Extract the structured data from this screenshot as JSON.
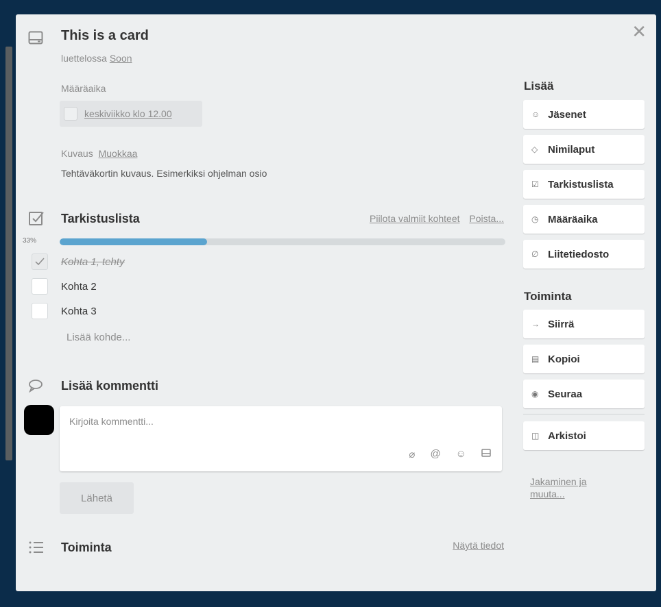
{
  "card": {
    "title": "This is a card",
    "in_list_prefix": "luettelossa",
    "list_name": "Soon",
    "close_symbol": "✕"
  },
  "due": {
    "label": "Määräaika",
    "value": "keskiviikko klo 12.00"
  },
  "description": {
    "label": "Kuvaus",
    "edit": "Muokkaa",
    "text": "Tehtäväkortin kuvaus. Esimerkiksi ohjelman osio"
  },
  "checklist": {
    "title": "Tarkistuslista",
    "hide_done": "Piilota valmiit kohteet",
    "delete": "Poista...",
    "percent_label": "33%",
    "progress": 0.33,
    "items": [
      {
        "text": "Kohta 1, tehty",
        "done": true
      },
      {
        "text": "Kohta 2",
        "done": false
      },
      {
        "text": "Kohta 3",
        "done": false
      }
    ],
    "add_item": "Lisää kohde..."
  },
  "comment": {
    "title": "Lisää kommentti",
    "placeholder": "Kirjoita kommentti...",
    "send": "Lähetä",
    "tools": [
      "paperclip-icon",
      "at-icon",
      "emoji-icon",
      "card-icon"
    ]
  },
  "activity": {
    "title": "Toiminta",
    "show_details": "Näytä tiedot"
  },
  "sidebar": {
    "add_heading": "Lisää",
    "add_items": [
      {
        "label": "Jäsenet",
        "icon": "person-icon"
      },
      {
        "label": "Nimilaput",
        "icon": "tag-icon"
      },
      {
        "label": "Tarkistuslista",
        "icon": "checkbox-icon"
      },
      {
        "label": "Määräaika",
        "icon": "clock-icon"
      },
      {
        "label": "Liitetiedosto",
        "icon": "paperclip-icon"
      }
    ],
    "actions_heading": "Toiminta",
    "action_items": [
      {
        "label": "Siirrä",
        "icon": "arrow-right-icon"
      },
      {
        "label": "Kopioi",
        "icon": "card-icon"
      },
      {
        "label": "Seuraa",
        "icon": "eye-icon"
      }
    ],
    "archive": {
      "label": "Arkistoi",
      "icon": "archive-icon"
    },
    "share_link": "Jakaminen ja muuta..."
  },
  "colors": {
    "background": "#0b2c4a",
    "modal": "#edeff0",
    "progress_fill": "#5ba4cf",
    "progress_track": "#d6dadc"
  }
}
